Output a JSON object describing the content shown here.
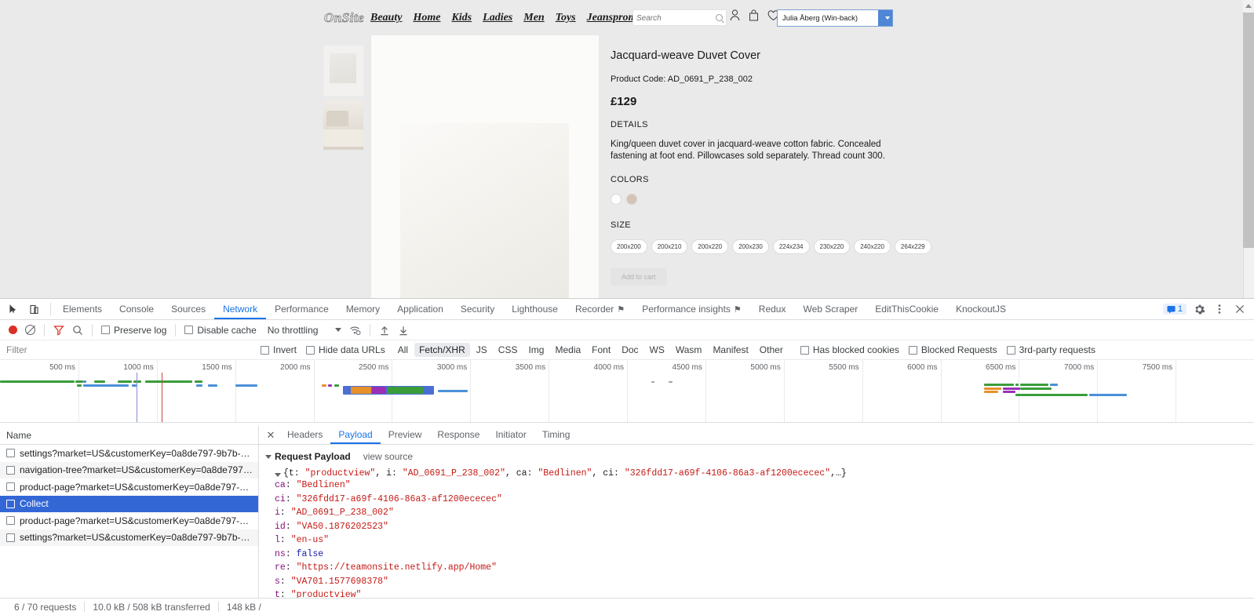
{
  "site": {
    "brand": "OnSite",
    "nav": [
      "Beauty",
      "Home",
      "Kids",
      "Ladies",
      "Men",
      "Toys",
      "Jeanspromos"
    ],
    "search_placeholder": "Search",
    "user_select_value": "Julia Åberg (Win-back)"
  },
  "product": {
    "title": "Jacquard-weave Duvet Cover",
    "code_label": "Product Code: AD_0691_P_238_002",
    "price": "£129",
    "details_heading": "DETAILS",
    "description": "King/queen duvet cover in jacquard-weave cotton fabric. Concealed fastening at foot end. Pillowcases sold separately. Thread count 300.",
    "colors_heading": "COLORS",
    "colors": [
      "#fdfdfd",
      "#d6c3b4"
    ],
    "size_heading": "SIZE",
    "sizes": [
      "200x200",
      "200x210",
      "200x220",
      "200x230",
      "224x234",
      "230x220",
      "240x220",
      "264x229"
    ],
    "add_to_cart": "Add to cart"
  },
  "devtools": {
    "tabs": [
      {
        "label": "Elements",
        "active": false
      },
      {
        "label": "Console",
        "active": false
      },
      {
        "label": "Sources",
        "active": false
      },
      {
        "label": "Network",
        "active": true
      },
      {
        "label": "Performance",
        "active": false
      },
      {
        "label": "Memory",
        "active": false
      },
      {
        "label": "Application",
        "active": false
      },
      {
        "label": "Security",
        "active": false
      },
      {
        "label": "Lighthouse",
        "active": false
      },
      {
        "label": "Recorder",
        "active": false,
        "warn": "⚑"
      },
      {
        "label": "Performance insights",
        "active": false,
        "warn": "⚑"
      },
      {
        "label": "Redux",
        "active": false
      },
      {
        "label": "Web Scraper",
        "active": false
      },
      {
        "label": "EditThisCookie",
        "active": false
      },
      {
        "label": "KnockoutJS",
        "active": false
      }
    ],
    "message_count": "1",
    "toolbar": {
      "preserve_log": "Preserve log",
      "disable_cache": "Disable cache",
      "throttling": "No throttling"
    },
    "filter": {
      "placeholder": "Filter",
      "invert": "Invert",
      "hide_data_urls": "Hide data URLs",
      "types": [
        {
          "label": "All",
          "active": false
        },
        {
          "label": "Fetch/XHR",
          "active": true
        },
        {
          "label": "JS",
          "active": false
        },
        {
          "label": "CSS",
          "active": false
        },
        {
          "label": "Img",
          "active": false
        },
        {
          "label": "Media",
          "active": false
        },
        {
          "label": "Font",
          "active": false
        },
        {
          "label": "Doc",
          "active": false
        },
        {
          "label": "WS",
          "active": false
        },
        {
          "label": "Wasm",
          "active": false
        },
        {
          "label": "Manifest",
          "active": false
        },
        {
          "label": "Other",
          "active": false
        }
      ],
      "has_blocked_cookies": "Has blocked cookies",
      "blocked_requests": "Blocked Requests",
      "third_party": "3rd-party requests"
    },
    "timeline": {
      "ticks": [
        "500 ms",
        "1000 ms",
        "1500 ms",
        "2000 ms",
        "2500 ms",
        "3000 ms",
        "3500 ms",
        "4000 ms",
        "4500 ms",
        "5000 ms",
        "5500 ms",
        "6000 ms",
        "6500 ms",
        "7000 ms",
        "7500 ms"
      ]
    },
    "requests": {
      "column": "Name",
      "rows": [
        {
          "name": "settings?market=US&customerKey=0a8de797-9b7b-…",
          "selected": false
        },
        {
          "name": "navigation-tree?market=US&customerKey=0a8de797…",
          "selected": false
        },
        {
          "name": "product-page?market=US&customerKey=0a8de797-…",
          "selected": false
        },
        {
          "name": "Collect",
          "selected": true
        },
        {
          "name": "product-page?market=US&customerKey=0a8de797-…",
          "selected": false
        },
        {
          "name": "settings?market=US&customerKey=0a8de797-9b7b-…",
          "selected": false
        }
      ]
    },
    "detail": {
      "tabs": [
        {
          "label": "Headers",
          "active": false
        },
        {
          "label": "Payload",
          "active": true
        },
        {
          "label": "Preview",
          "active": false
        },
        {
          "label": "Response",
          "active": false
        },
        {
          "label": "Initiator",
          "active": false
        },
        {
          "label": "Timing",
          "active": false
        }
      ],
      "payload_title": "Request Payload",
      "view_source": "view source",
      "root_summary": "{t: \"productview\", i: \"AD_0691_P_238_002\", ca: \"Bedlinen\", ci: \"326fdd17-a69f-4106-86a3-af1200ececec\",…}",
      "entries": [
        {
          "key": "ca",
          "value": "\"Bedlinen\"",
          "type": "string"
        },
        {
          "key": "ci",
          "value": "\"326fdd17-a69f-4106-86a3-af1200ececec\"",
          "type": "string"
        },
        {
          "key": "i",
          "value": "\"AD_0691_P_238_002\"",
          "type": "string"
        },
        {
          "key": "id",
          "value": "\"VA50.1876202523\"",
          "type": "string"
        },
        {
          "key": "l",
          "value": "\"en-us\"",
          "type": "string"
        },
        {
          "key": "ns",
          "value": "false",
          "type": "bool"
        },
        {
          "key": "re",
          "value": "\"https://teamonsite.netlify.app/Home\"",
          "type": "string"
        },
        {
          "key": "s",
          "value": "\"VA701.1577698378\"",
          "type": "string"
        },
        {
          "key": "t",
          "value": "\"productview\"",
          "type": "string"
        }
      ]
    },
    "status": {
      "requests": "6 / 70 requests",
      "transferred": "10.0 kB / 508 kB transferred",
      "resources": "148 kB /"
    }
  }
}
